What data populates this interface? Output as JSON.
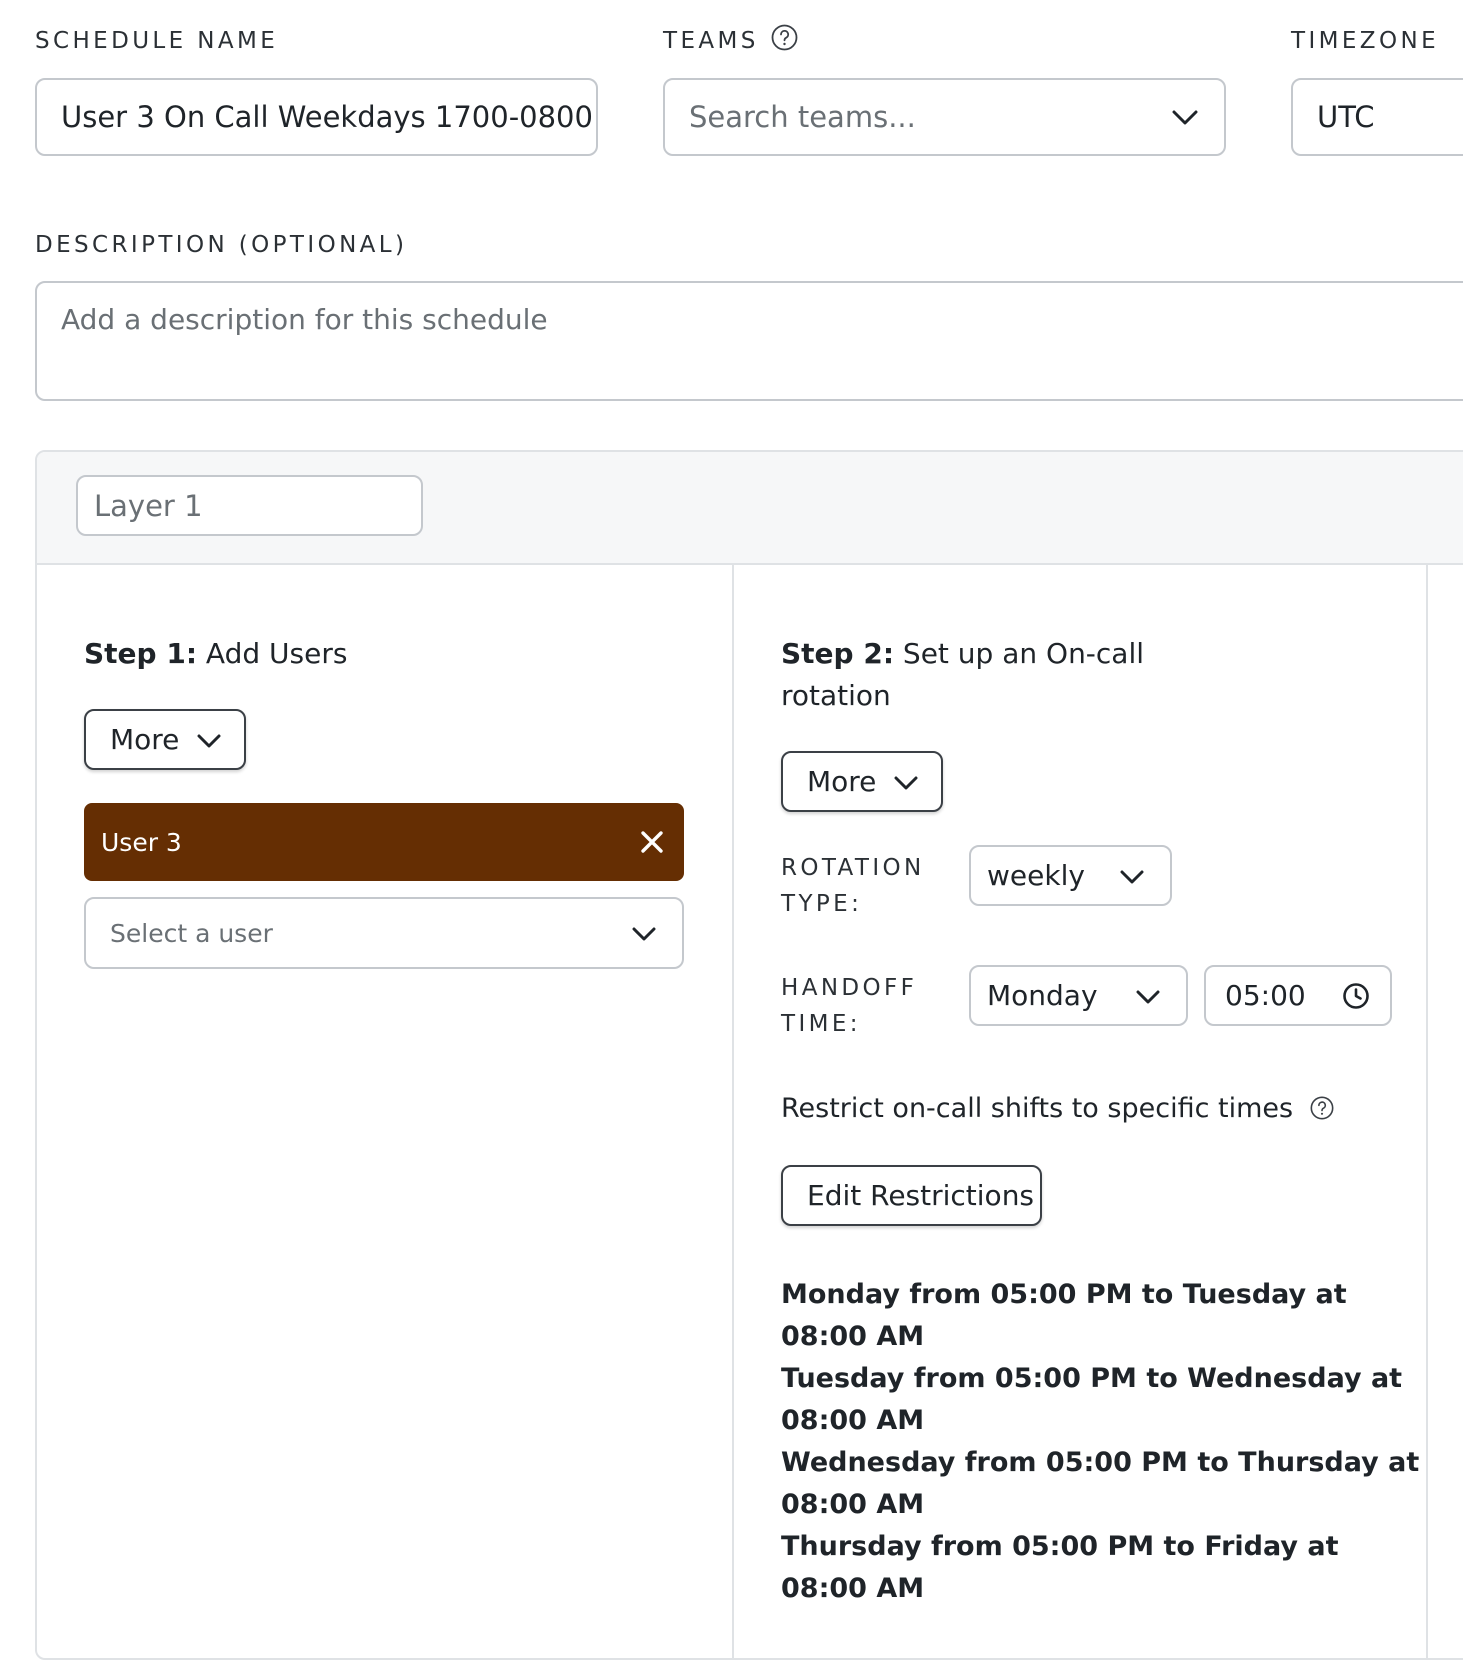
{
  "schedule_name": {
    "label": "SCHEDULE NAME",
    "value": "User 3 On Call Weekdays 1700-0800"
  },
  "teams": {
    "label": "TEAMS",
    "placeholder": "Search teams..."
  },
  "timezone": {
    "label": "TIMEZONE",
    "value": "UTC"
  },
  "description": {
    "label": "DESCRIPTION (OPTIONAL)",
    "placeholder": "Add a description for this schedule"
  },
  "layer": {
    "name": "Layer 1",
    "step1": {
      "title_bold": "Step 1:",
      "title_rest": "Add Users",
      "more_label": "More",
      "users": [
        {
          "name": "User 3",
          "color": "#652e03"
        }
      ],
      "select_placeholder": "Select a user"
    },
    "step2": {
      "title_bold": "Step 2:",
      "title_rest": "Set up an On-call",
      "title_line2": "rotation",
      "more_label": "More",
      "rotation_type_label_1": "ROTATION",
      "rotation_type_label_2": "TYPE:",
      "rotation_type_value": "weekly",
      "handoff_label_1": "HANDOFF",
      "handoff_label_2": "TIME:",
      "handoff_day": "Monday",
      "handoff_time": "05:00",
      "restrict_text": "Restrict on-call shifts to specific times",
      "edit_restrictions_label": "Edit Restrictions",
      "restrictions": [
        {
          "line1": "Monday from 05:00 PM to Tuesday at",
          "line2": "08:00 AM"
        },
        {
          "line1": "Tuesday from 05:00 PM to Wednesday at",
          "line2": "08:00 AM"
        },
        {
          "line1": "Wednesday from 05:00 PM to Thursday at",
          "line2": "08:00 AM"
        },
        {
          "line1": "Thursday from 05:00 PM to Friday at",
          "line2": "08:00 AM"
        }
      ]
    }
  },
  "icons": {
    "help": "help-circle-icon",
    "chevron": "chevron-down-icon",
    "remove": "close-icon",
    "clock": "clock-icon"
  },
  "colors": {
    "user_chip": "#652e03",
    "field_border": "#c4c8cd",
    "button_border": "#3b4046",
    "panel_bg": "#f6f7f8"
  }
}
